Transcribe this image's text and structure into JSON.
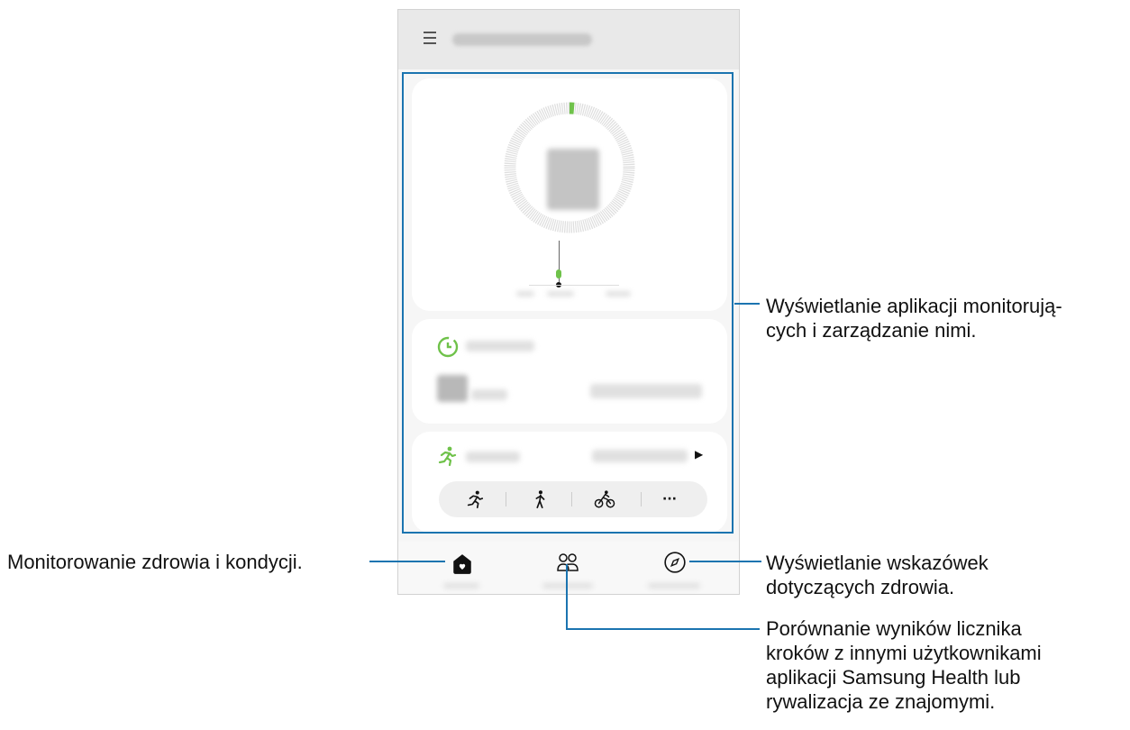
{
  "annotations": {
    "monitoring_apps": [
      "Wyświetlanie aplikacji monitorują-",
      "cych i zarządzanie nimi."
    ],
    "health_monitor": "Monitorowanie zdrowia i kondycji.",
    "health_tips": [
      "Wyświetlanie wskazówek",
      "dotyczących zdrowia."
    ],
    "compare_results": [
      "Porównanie wyników licznika",
      "kroków z innymi użytkownikami",
      "aplikacji Samsung Health lub",
      "rywalizacja ze znajomymi."
    ]
  },
  "colors": {
    "accent": "#1b74b0",
    "green": "#6fc24a"
  },
  "icons": {
    "menu": "menu-icon",
    "sleep": "sleep-icon",
    "run": "run-icon",
    "walk": "walk-icon",
    "cycle": "cycle-icon",
    "more": "more-icon",
    "home": "home-icon",
    "together": "people-icon",
    "discover": "compass-icon"
  },
  "ui": {
    "more_glyph": "···",
    "play_glyph": "▶"
  }
}
